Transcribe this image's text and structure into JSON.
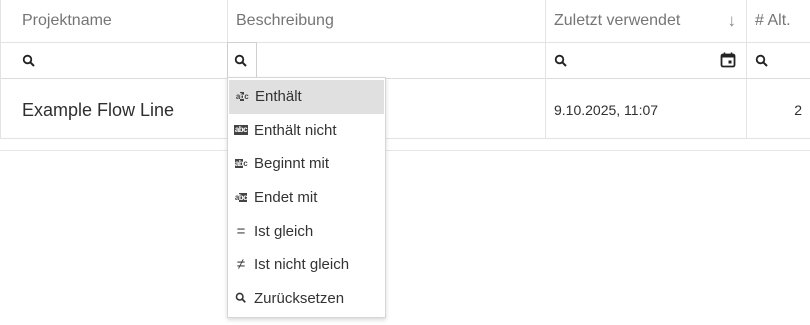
{
  "columns": [
    {
      "label": "Projektname"
    },
    {
      "label": "Beschreibung"
    },
    {
      "label": "Zuletzt verwendet",
      "sort_icon": "↓"
    },
    {
      "label": "# Alt."
    }
  ],
  "rows": [
    {
      "projektname": "Example Flow Line",
      "beschreibung": "",
      "zuletzt_verwendet": "9.10.2025, 11:07",
      "alt": "2"
    }
  ],
  "filter_menu": {
    "items": [
      {
        "label": "Enthält",
        "icon": "contains-icon",
        "active": true
      },
      {
        "label": "Enthält nicht",
        "icon": "not-contains-icon"
      },
      {
        "label": "Beginnt mit",
        "icon": "starts-with-icon"
      },
      {
        "label": "Endet mit",
        "icon": "ends-with-icon"
      },
      {
        "label": "Ist gleich",
        "icon": "equals-icon"
      },
      {
        "label": "Ist nicht gleich",
        "icon": "not-equals-icon"
      },
      {
        "label": "Zurücksetzen",
        "icon": "search-icon"
      }
    ]
  }
}
